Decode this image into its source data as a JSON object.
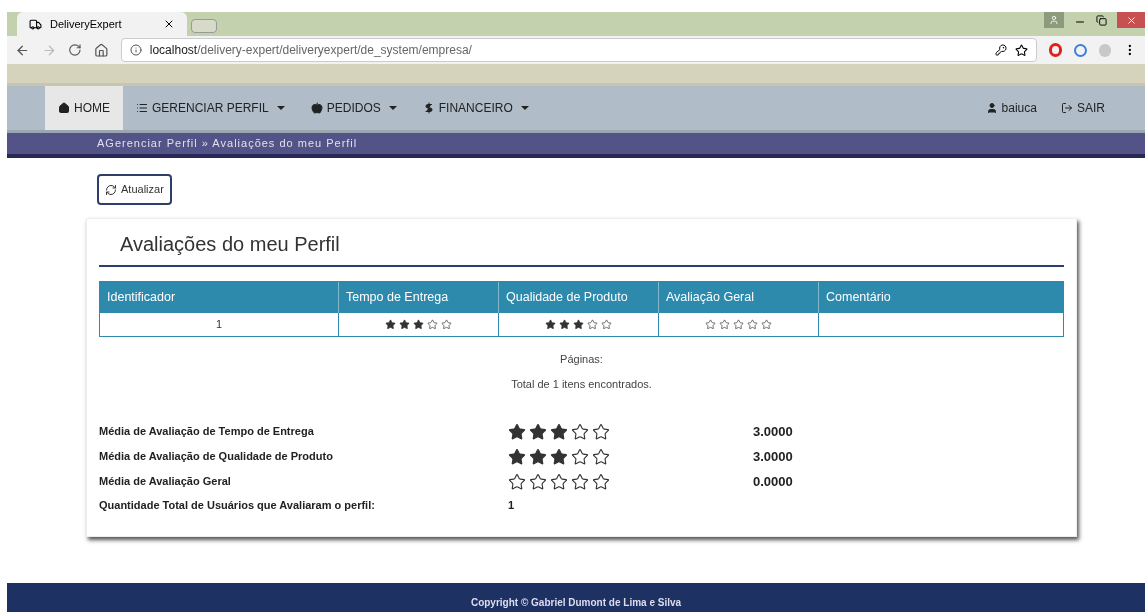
{
  "browser": {
    "tab_title": "DeliveryExpert",
    "url_host": "localhost",
    "url_path": "/delivery-expert/deliveryexpert/de_system/empresa/"
  },
  "nav": {
    "items": [
      {
        "label": "HOME",
        "dropdown": false,
        "selected": true
      },
      {
        "label": "GERENCIAR PERFIL",
        "dropdown": true,
        "selected": false
      },
      {
        "label": "PEDIDOS",
        "dropdown": true,
        "selected": false
      },
      {
        "label": "FINANCEIRO",
        "dropdown": true,
        "selected": false
      }
    ],
    "user": "baiuca",
    "logout": "SAIR"
  },
  "breadcrumb": "AGerenciar Perfil » Avaliações do meu Perfil",
  "refresh_button": "Atualizar",
  "card": {
    "title": "Avaliações do meu Perfil",
    "table": {
      "columns": [
        "Identificador",
        "Tempo de Entrega",
        "Qualidade de Produto",
        "Avaliação Geral",
        "Comentário"
      ],
      "rows": [
        {
          "id": "1",
          "delivery": {
            "stars": 3
          },
          "quality": {
            "stars": 3
          },
          "overall": {
            "stars": 0
          }
        }
      ]
    },
    "pages_label": "Páginas:",
    "total_label": "Total de 1 itens encontrados.",
    "summary": [
      {
        "label": "Média de Avaliação de Tempo de Entrega",
        "stars": 3,
        "value": "3.0000"
      },
      {
        "label": "Média de Avaliação de Qualidade de Produto",
        "stars": 3,
        "value": "3.0000"
      },
      {
        "label": "Média de Avaliação Geral",
        "stars": 0,
        "value": "0.0000"
      }
    ],
    "users_label": "Quantidade Total de Usuários que Avaliaram o perfil:",
    "users_count": "1"
  },
  "footer": "Copyright © Gabriel Dumont de Lima e Silva"
}
